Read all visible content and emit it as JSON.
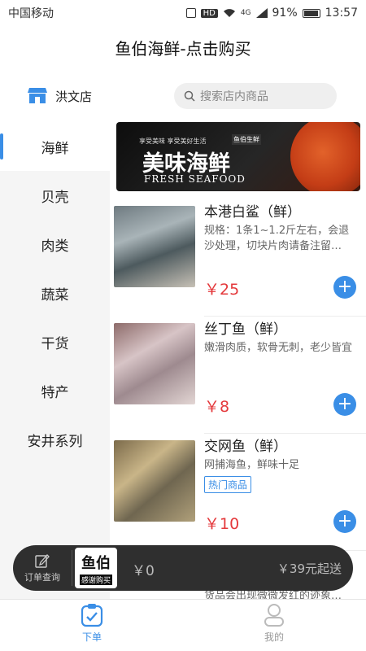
{
  "status_bar": {
    "carrier": "中国移动",
    "network": "4G",
    "battery": "91%",
    "time": "13:57",
    "hd": "HD"
  },
  "header": {
    "title": "鱼伯海鲜-点击购买"
  },
  "store": {
    "name": "洪文店",
    "search_placeholder": "搜索店内商品"
  },
  "sidebar": {
    "items": [
      "海鲜",
      "贝壳",
      "肉类",
      "蔬菜",
      "干货",
      "特产",
      "安井系列"
    ],
    "active_index": 0
  },
  "banner": {
    "subtitle": "享受美味 享受美好生活",
    "brand": "鱼伯生鲜",
    "title": "美味海鲜",
    "english": "FRESH SEAFOOD"
  },
  "products": [
    {
      "name": "本港白鲨（鲜）",
      "desc": "规格：1条1~1.2斤左右，会退沙处理，切块片肉请备注留…",
      "price": "￥25"
    },
    {
      "name": "丝丁鱼（鲜）",
      "desc": "嫩滑肉质，软骨无刺，老少皆宜",
      "price": "￥8"
    },
    {
      "name": "交网鱼（鲜）",
      "desc": "网捕海鱼，鲜味十足",
      "tag": "热门商品",
      "price": "￥10"
    },
    {
      "desc": "货品会出现微微发红的迹象…"
    }
  ],
  "cart": {
    "order_label": "订单查询",
    "logo_main": "鱼伯",
    "logo_sub": "感谢购买",
    "total": "￥0",
    "min_order": "￥39元起送"
  },
  "tab_bar": {
    "tabs": [
      {
        "label": "下单",
        "active": true
      },
      {
        "label": "我的",
        "active": false
      }
    ]
  },
  "colors": {
    "accent": "#3a8ee6",
    "price": "#e4393c",
    "cart_bg": "#2f2f2f"
  }
}
